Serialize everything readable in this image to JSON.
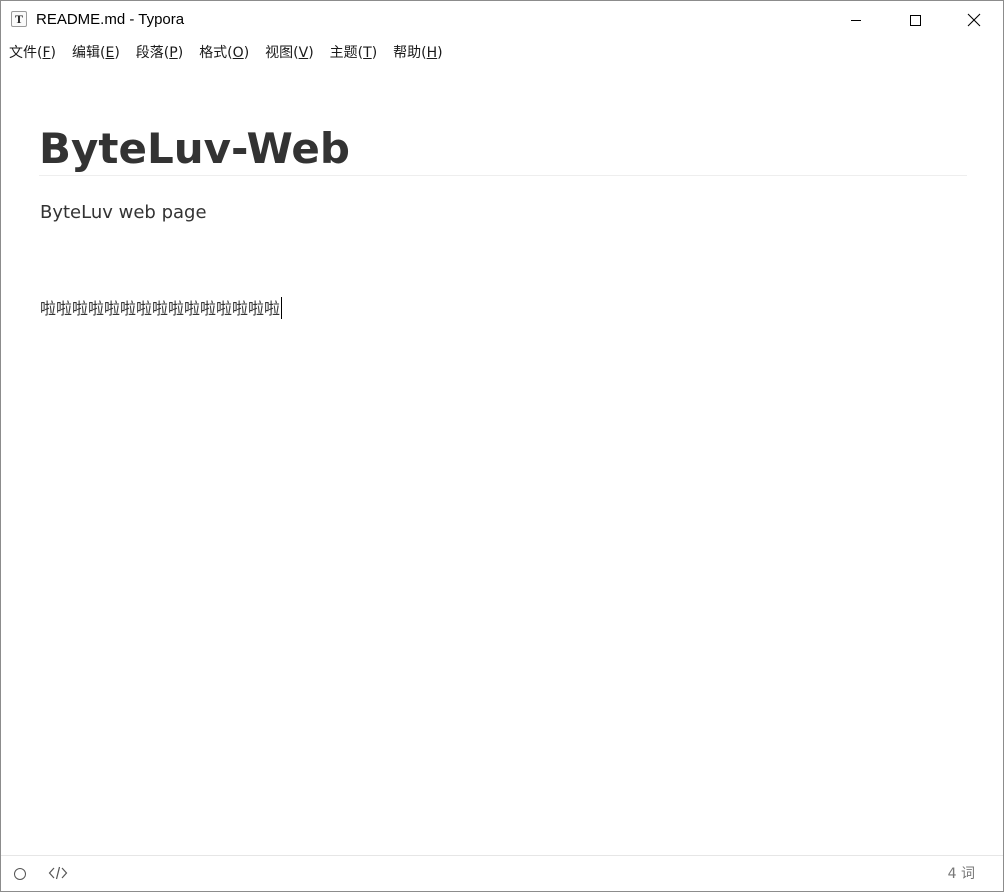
{
  "window": {
    "app_icon_letter": "T",
    "title": "README.md - Typora"
  },
  "menu": [
    {
      "label": "文件(",
      "key": "F",
      "suffix": ")"
    },
    {
      "label": "编辑(",
      "key": "E",
      "suffix": ")"
    },
    {
      "label": "段落(",
      "key": "P",
      "suffix": ")"
    },
    {
      "label": "格式(",
      "key": "O",
      "suffix": ")"
    },
    {
      "label": "视图(",
      "key": "V",
      "suffix": ")"
    },
    {
      "label": "主题(",
      "key": "T",
      "suffix": ")"
    },
    {
      "label": "帮助(",
      "key": "H",
      "suffix": ")"
    }
  ],
  "document": {
    "heading": "ByteLuv-Web",
    "subtitle": "ByteLuv web page",
    "paragraph": "啦啦啦啦啦啦啦啦啦啦啦啦啦啦啦"
  },
  "statusbar": {
    "word_count": "4 词"
  },
  "icons": {
    "app": "typora-icon",
    "minimize": "minimize-icon",
    "maximize": "maximize-icon",
    "close": "close-icon",
    "outline": "outline-toggle-icon",
    "source": "source-code-icon"
  }
}
